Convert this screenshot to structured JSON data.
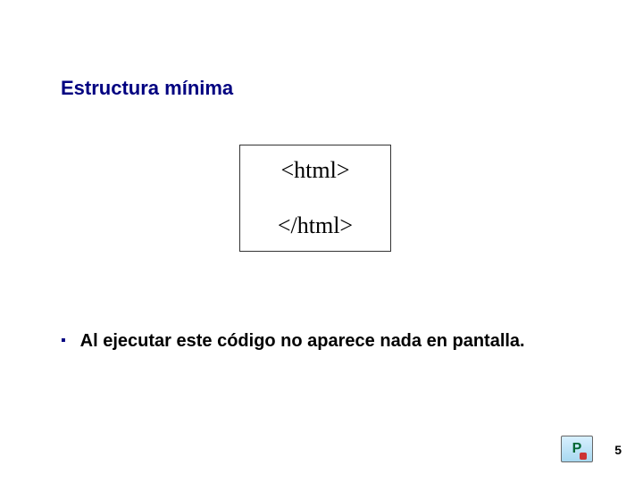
{
  "slide": {
    "title": "Estructura mínima",
    "code": {
      "line1": "<html>",
      "line2": "</html>"
    },
    "bullet": {
      "marker": "▪",
      "text": "Al ejecutar este código no aparece nada en pantalla."
    },
    "footer": {
      "logo_letter": "P",
      "page_number": "5"
    }
  }
}
